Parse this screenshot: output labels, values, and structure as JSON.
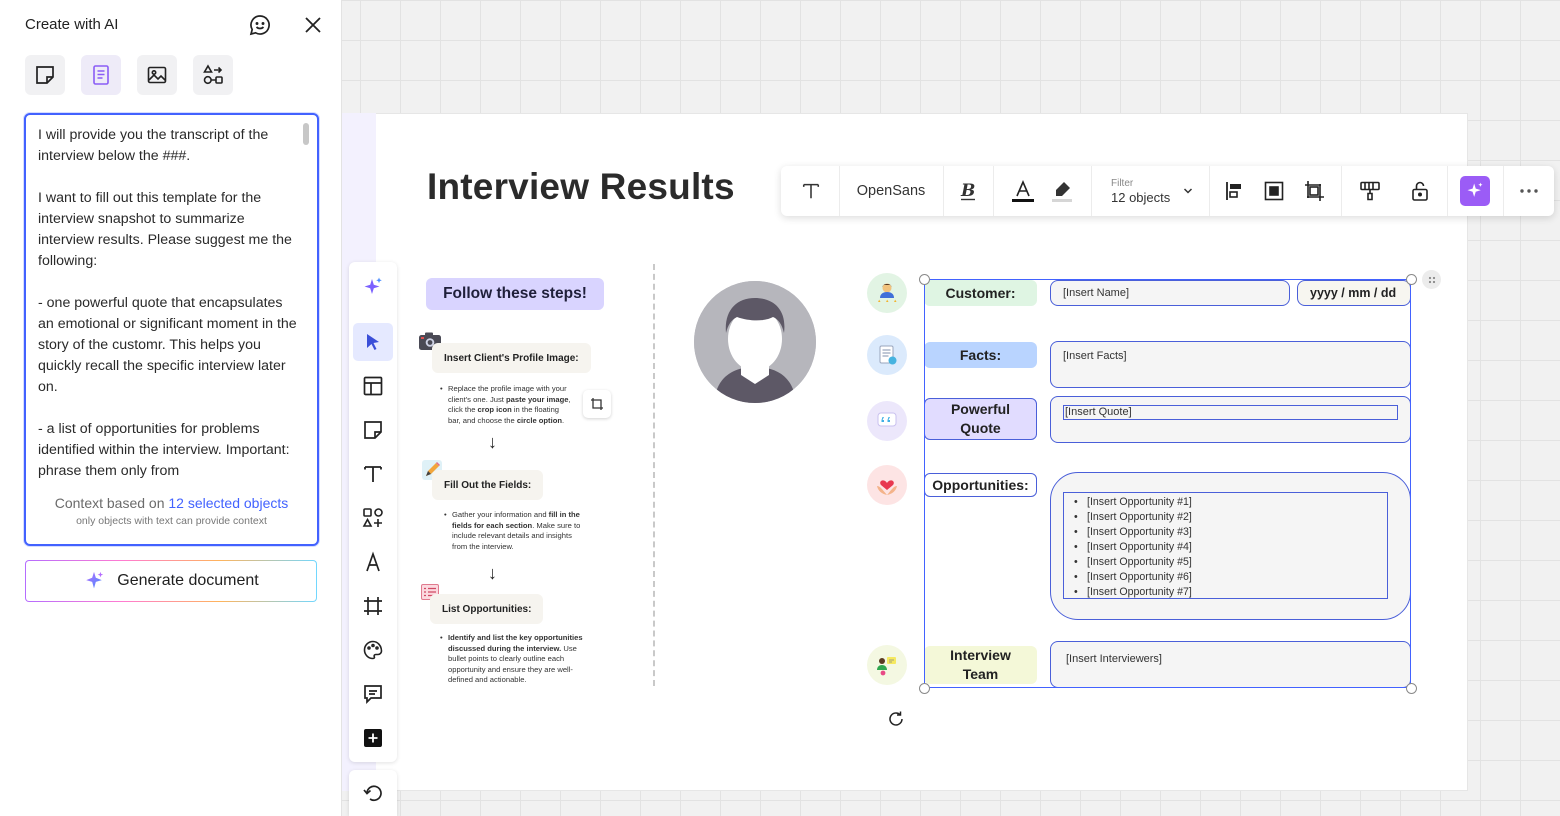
{
  "ai_panel": {
    "title": "Create with AI",
    "prompt_text": "I will provide you the transcript of the interview below the ###.\n\nI want to fill out this template for the interview snapshot to summarize interview results. Please suggest me the following:\n\n- one powerful quote that encapsulates an emotional or significant moment in the story of the customr. This helps you quickly recall the specific interview later on.\n\n- a list of opportunities for problems identified within the interview. Important: phrase them only from",
    "context_prefix": "Context based on ",
    "context_link": "12 selected objects",
    "context_note": "only objects with text can provide context",
    "generate_label": "Generate document",
    "modes": [
      "sticky-note-icon",
      "document-icon",
      "image-icon",
      "diagram-icon"
    ]
  },
  "board": {
    "title": "Interview Results"
  },
  "context_toolbar": {
    "font_name": "OpenSans",
    "filter_label": "Filter",
    "filter_value": "12 objects"
  },
  "steps": {
    "header": "Follow these steps!",
    "step1_title": "Insert Client's Profile Image:",
    "step1_line1": "Replace the profile image with your",
    "step1_line2": "client's one. Just ",
    "step1_line2_bold": "paste your image",
    "step1_line3": "click the ",
    "step1_line3_bold": "crop icon",
    "step1_line3_tail": " in the floating",
    "step1_line4": "bar, and choose the ",
    "step1_line4_bold": "circle option",
    "step2_title": "Fill Out the Fields:",
    "step2_line1": "Gather your information and ",
    "step2_line1_bold": "fill in the",
    "step2_line2_bold": "fields for each section",
    "step2_line2": ". Make sure to",
    "step2_line3": "include relevant details and insights",
    "step2_line4": "from the interview.",
    "step3_title": "List Opportunities:",
    "step3_line1_bold": "Identify and list the key opportunities",
    "step3_line2_bold": "discussed during the interview.",
    "step3_line2": " Use",
    "step3_line3": "bullet points to clearly outline each",
    "step3_line4": "opportunity and ensure they are well-",
    "step3_line5": "defined and actionable.",
    "arrow": "↓"
  },
  "template": {
    "customer_label": "Customer:",
    "customer_value": "[Insert Name]",
    "date_value": "yyyy / mm / dd",
    "facts_label": "Facts:",
    "facts_value": "[Insert Facts]",
    "quote_label": "Powerful Quote",
    "quote_value": "[Insert Quote]",
    "opportunities_label": "Opportunities:",
    "opportunities": [
      "[Insert Opportunity #1]",
      "[Insert Opportunity #2]",
      "[Insert Opportunity #3]",
      "[Insert Opportunity #4]",
      "[Insert Opportunity #5]",
      "[Insert Opportunity #6]",
      "[Insert Opportunity #7]"
    ],
    "team_label": "Interview Team",
    "team_value": "[Insert Interviewers]"
  },
  "colors": {
    "accent": "#4262ff",
    "steps_pill": "#d9d4ff",
    "customer_pill": "#dff5e3",
    "facts_pill": "#b9d4ff",
    "quote_pill": "#e1dcff",
    "opportunities_pill": "#ffffff",
    "team_pill": "#f4f8d8"
  }
}
